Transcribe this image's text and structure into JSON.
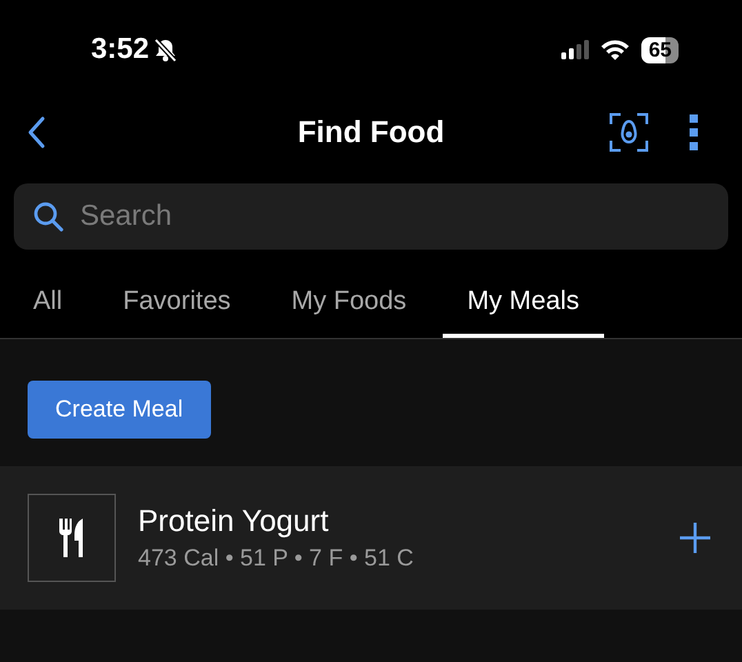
{
  "status_bar": {
    "time": "3:52",
    "silent": true,
    "battery": "65"
  },
  "nav": {
    "title": "Find Food"
  },
  "search": {
    "placeholder": "Search"
  },
  "tabs": [
    {
      "label": "All",
      "selected": false
    },
    {
      "label": "Favorites",
      "selected": false
    },
    {
      "label": "My Foods",
      "selected": false
    },
    {
      "label": "My Meals",
      "selected": true
    }
  ],
  "create_button": "Create Meal",
  "meals": [
    {
      "name": "Protein Yogurt",
      "details": "473 Cal • 51 P • 7 F • 51 C"
    }
  ]
}
